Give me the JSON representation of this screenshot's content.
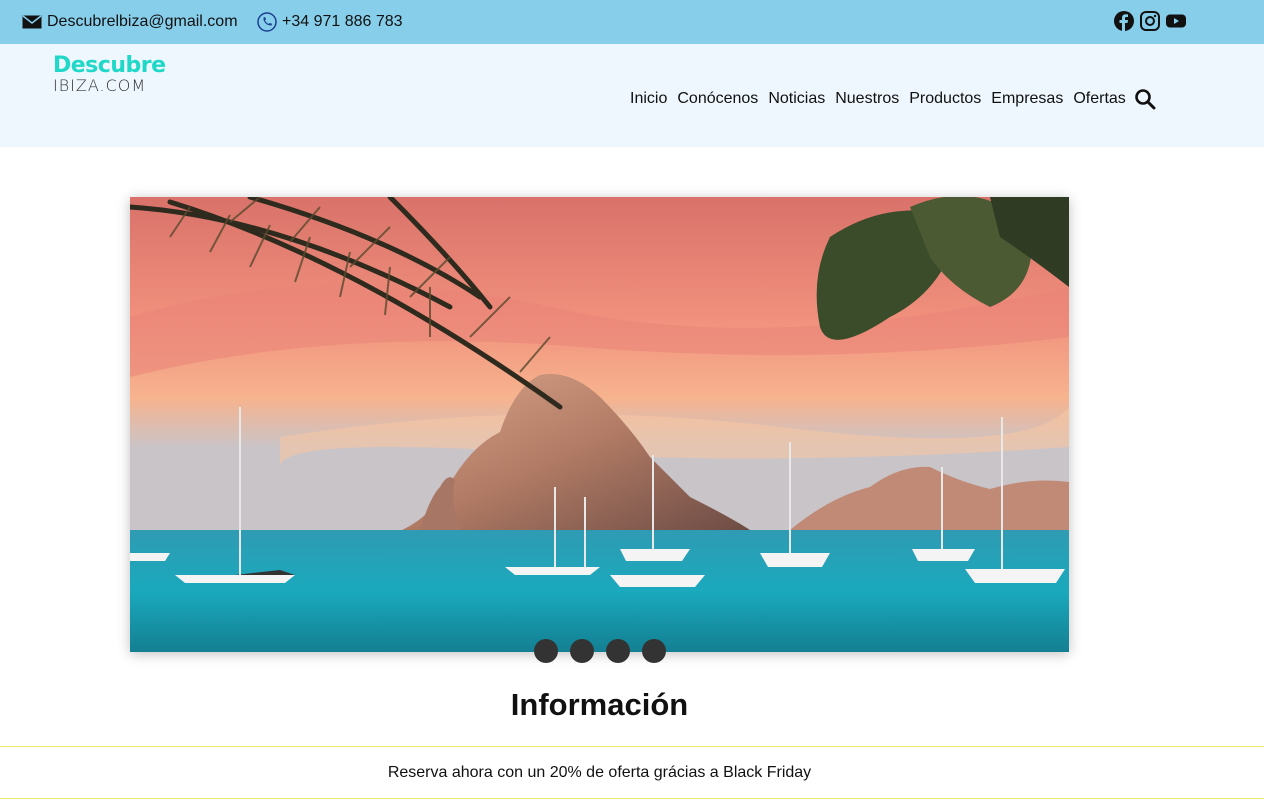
{
  "topbar": {
    "email": "Descubrelbiza@gmail.com",
    "phone": "+34 971 886 783",
    "icons": {
      "email": "envelope-icon",
      "phone": "phone-icon"
    },
    "social": [
      "facebook-icon",
      "instagram-icon",
      "youtube-icon"
    ],
    "background": "#87ceeb"
  },
  "header": {
    "logo_top": "Descubre",
    "logo_bottom": "IBIZA.COM",
    "logo_color": "#1fd8c8",
    "nav": [
      "Inicio",
      "Conócenos",
      "Noticias",
      "Nuestros",
      "Productos",
      "Empresas",
      "Ofertas"
    ],
    "search_icon": "search-icon"
  },
  "carousel": {
    "slide_count": 4,
    "active_slide": 1
  },
  "main": {
    "section_title": "Información",
    "banner_text": "Reserva ahora con un 20% de oferta grácias a Black Friday"
  }
}
